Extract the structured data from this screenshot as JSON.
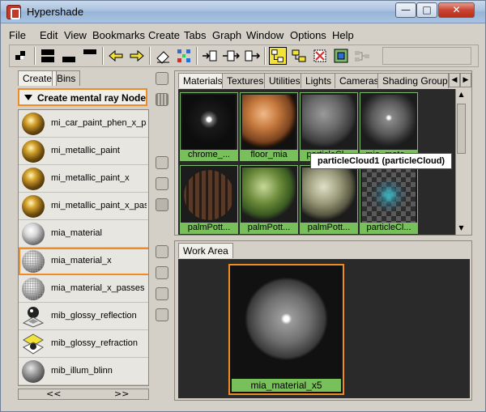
{
  "window": {
    "title": "Hypershade"
  },
  "window_controls": {
    "minimize": "—",
    "maximize": "□",
    "close": "✕"
  },
  "menu": [
    "File",
    "Edit",
    "View",
    "Bookmarks",
    "Create",
    "Tabs",
    "Graph",
    "Window",
    "Options",
    "Help"
  ],
  "toolbar": {
    "icons": [
      "layout-single-icon",
      "layout-top-icon",
      "layout-bottom-icon",
      "layout-horizontal-icon",
      "arrow-left-icon",
      "arrow-right-icon",
      "eraser-icon",
      "rearrange-graph-icon",
      "input-connections-icon",
      "input-output-connections-icon",
      "output-connections-icon",
      "toggle-node-view-icon",
      "toggle-graph-view-icon",
      "clear-graph-icon",
      "graph-materials-icon",
      "graph-network-icon"
    ]
  },
  "left_panel": {
    "tabs": [
      "Create",
      "Bins"
    ],
    "active_tab": "Create",
    "dropdown": "Create mental ray Nodes",
    "nodes": [
      {
        "label": "mi_car_paint_phen_x_passes",
        "icon": "gold-sphere-icon"
      },
      {
        "label": "mi_metallic_paint",
        "icon": "gold-sphere-icon"
      },
      {
        "label": "mi_metallic_paint_x",
        "icon": "gold-sphere-icon"
      },
      {
        "label": "mi_metallic_paint_x_passes",
        "icon": "gold-sphere-icon"
      },
      {
        "label": "mia_material",
        "icon": "white-sphere-icon"
      },
      {
        "label": "mia_material_x",
        "icon": "dotted-sphere-icon",
        "selected": true
      },
      {
        "label": "mia_material_x_passes",
        "icon": "dotted-sphere-icon"
      },
      {
        "label": "mib_glossy_reflection",
        "icon": "reflection-icon"
      },
      {
        "label": "mib_glossy_refraction",
        "icon": "refraction-icon"
      },
      {
        "label": "mib_illum_blinn",
        "icon": "grey-sphere-icon"
      }
    ],
    "scroll_left": "<<",
    "scroll_right": ">>"
  },
  "top_panel": {
    "tabs": [
      "Materials",
      "Textures",
      "Utilities",
      "Lights",
      "Cameras",
      "Shading Groups"
    ],
    "active_tab": "Materials",
    "swatches": [
      {
        "label": "chrome_...",
        "kind": "chrome"
      },
      {
        "label": "floor_mia",
        "kind": "wood"
      },
      {
        "label": "particleCl...",
        "kind": "grey"
      },
      {
        "label": "mia_mate...",
        "kind": "grey-dot"
      },
      {
        "label": "palmPott...",
        "kind": "stripes"
      },
      {
        "label": "palmPott...",
        "kind": "leafy"
      },
      {
        "label": "palmPott...",
        "kind": "leafy-light"
      },
      {
        "label": "particleCl...",
        "kind": "checker"
      }
    ],
    "tooltip": "particleCloud1 (particleCloud)"
  },
  "work_area": {
    "tab": "Work Area",
    "node_label": "mia_material_x5"
  },
  "colors": {
    "selection": "#f08a24",
    "swatch_label": "#78c05a",
    "panel_bg": "#d4d0c8",
    "canvas_bg": "#2a2a2a"
  }
}
